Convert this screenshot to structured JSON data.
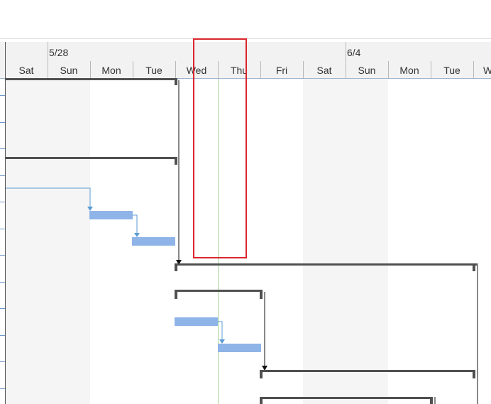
{
  "timescale": {
    "weeks": [
      "5/28",
      "6/4"
    ],
    "days": [
      "Sat",
      "Sun",
      "Mon",
      "Tue",
      "Wed",
      "Thu",
      "Fri",
      "Sat",
      "Sun",
      "Mon",
      "Tue",
      "W"
    ]
  },
  "colors": {
    "task_bar": "#8fb4e8",
    "summary_bar": "#505050",
    "link_line": "#5b9bd5",
    "current_day_line": "#a6d49a",
    "highlight": "#d9262c"
  },
  "status_date": "Thu"
}
